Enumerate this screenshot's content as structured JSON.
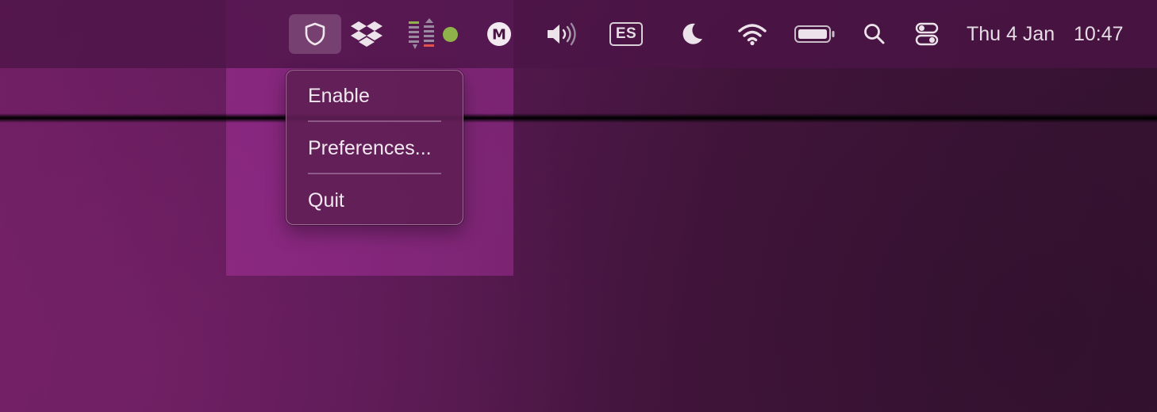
{
  "menubar": {
    "icons": {
      "shield": "shield-icon",
      "dropbox": "dropbox-icon",
      "meter": "audio-meter-icon",
      "mega": "mega-icon",
      "volume": "volume-icon",
      "input_source": "keyboard-input-source-icon",
      "focus": "moon-icon",
      "wifi": "wifi-icon",
      "battery": "battery-icon",
      "search": "search-icon",
      "control_center": "control-center-icon"
    },
    "status_dot_color": "#8fb34a",
    "mega_letter": "M",
    "input_source_label": "ES",
    "date": "Thu 4 Jan",
    "time": "10:47"
  },
  "dropdown": {
    "items": [
      {
        "label": "Enable"
      },
      {
        "label": "Preferences..."
      },
      {
        "label": "Quit"
      }
    ]
  },
  "colors": {
    "menu_background": "#5f1e55",
    "highlight": "#c83cbe",
    "text": "#f1e8ef"
  }
}
